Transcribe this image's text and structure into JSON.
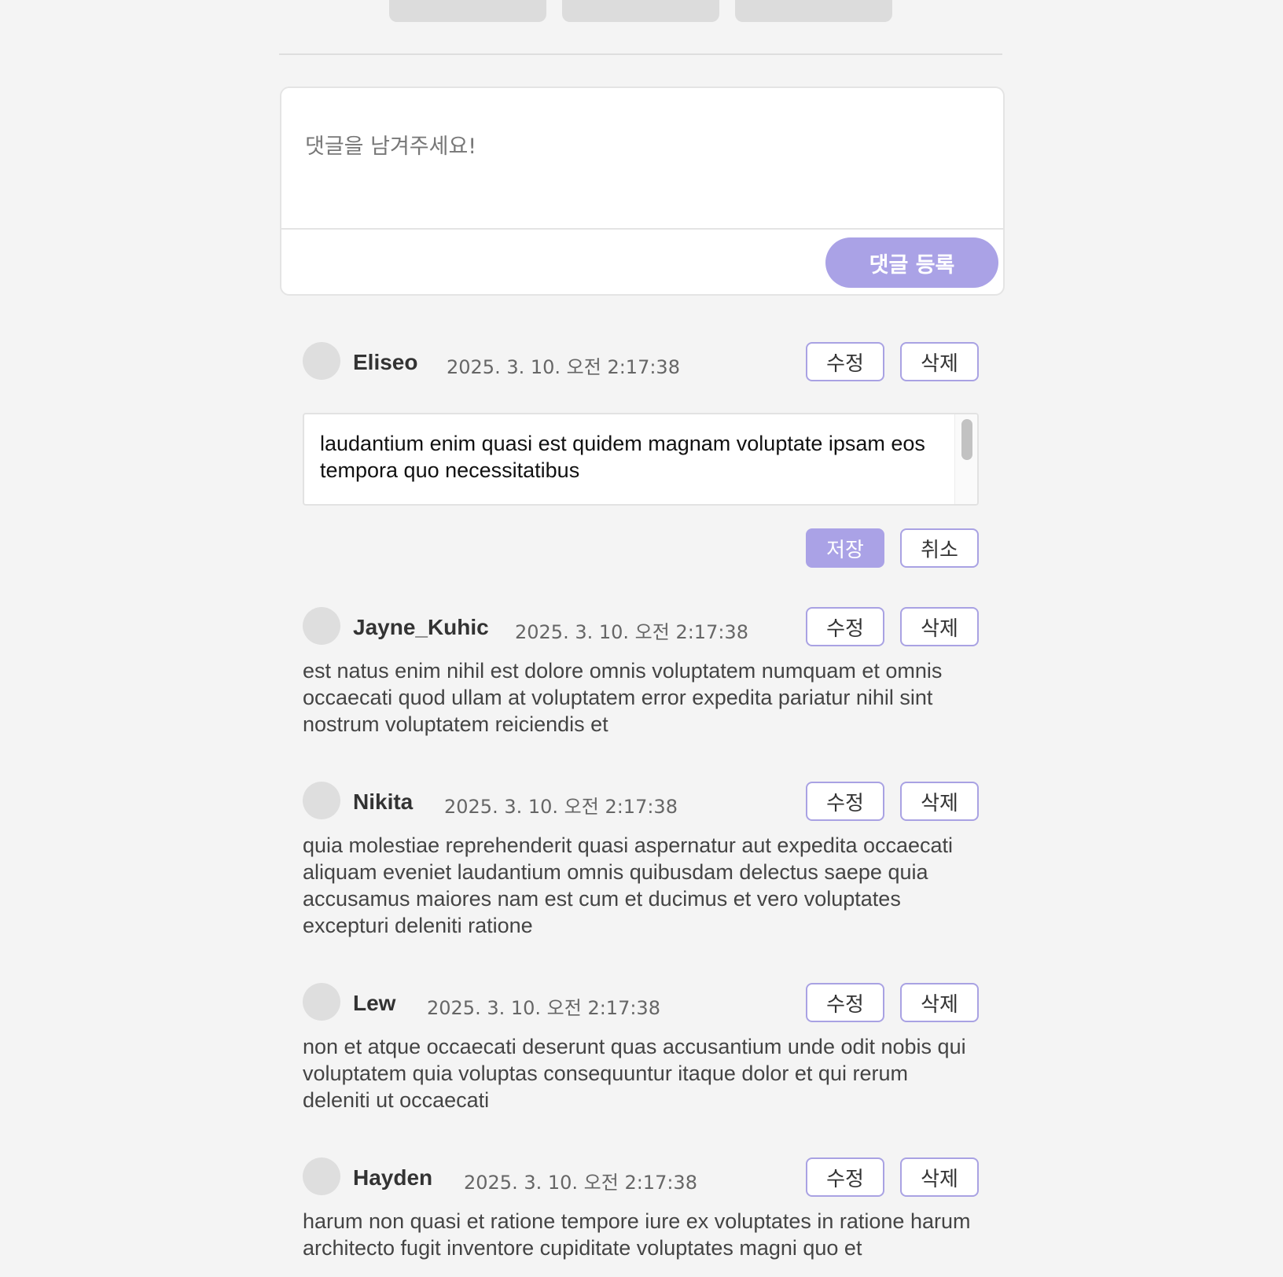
{
  "colors": {
    "background": "#f4f4f4",
    "accent": "#aaa2e6",
    "accent_border": "#a9a2e3",
    "avatar": "#dedede"
  },
  "composer": {
    "placeholder": "댓글을 남겨주세요!",
    "submit_label": "댓글 등록"
  },
  "comments": [
    {
      "author": "Eliseo",
      "timestamp": "2025. 3. 10. 오전 2:17:38",
      "edit_label": "수정",
      "delete_label": "삭제",
      "editing": true,
      "edit_text": "laudantium enim quasi est quidem magnam voluptate ipsam eos\ntempora quo necessitatibus",
      "save_label": "저장",
      "cancel_label": "취소"
    },
    {
      "author": "Jayne_Kuhic",
      "timestamp": "2025. 3. 10. 오전 2:17:38",
      "edit_label": "수정",
      "delete_label": "삭제",
      "body": "est natus enim nihil est dolore omnis voluptatem numquam et omnis occaecati quod ullam at voluptatem error expedita pariatur nihil sint nostrum voluptatem reiciendis et"
    },
    {
      "author": "Nikita",
      "timestamp": "2025. 3. 10. 오전 2:17:38",
      "edit_label": "수정",
      "delete_label": "삭제",
      "body": "quia molestiae reprehenderit quasi aspernatur aut expedita occaecati aliquam eveniet laudantium omnis quibusdam delectus saepe quia accusamus maiores nam est cum et ducimus et vero voluptates excepturi deleniti ratione"
    },
    {
      "author": "Lew",
      "timestamp": "2025. 3. 10. 오전 2:17:38",
      "edit_label": "수정",
      "delete_label": "삭제",
      "body": "non et atque occaecati deserunt quas accusantium unde odit nobis qui voluptatem quia voluptas consequuntur itaque dolor et qui rerum deleniti ut occaecati"
    },
    {
      "author": "Hayden",
      "timestamp": "2025. 3. 10. 오전 2:17:38",
      "edit_label": "수정",
      "delete_label": "삭제",
      "body": "harum non quasi et ratione tempore iure ex voluptates in ratione harum architecto fugit inventore cupiditate voluptates magni quo et"
    }
  ]
}
